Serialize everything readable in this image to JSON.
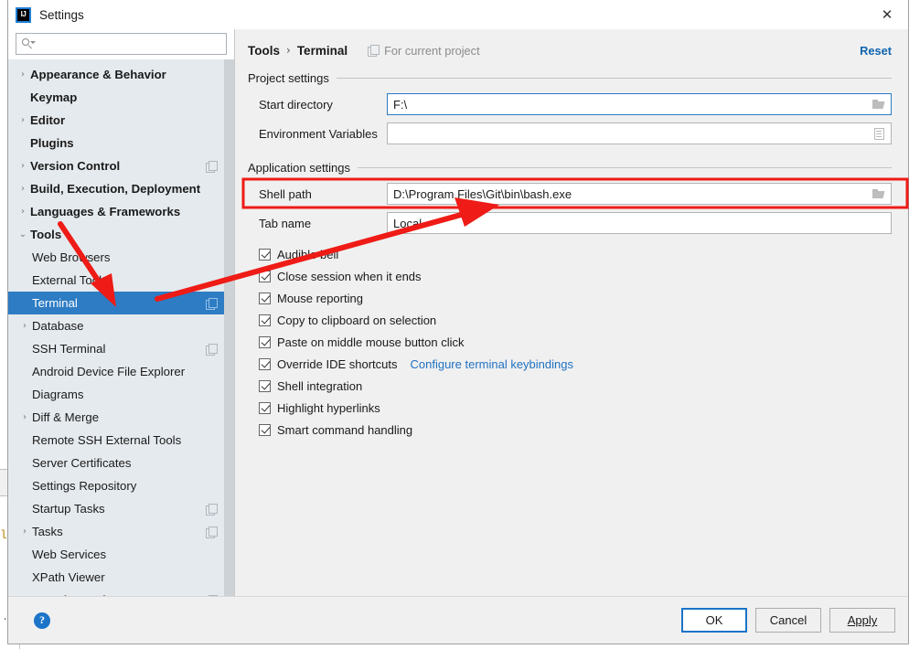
{
  "window": {
    "title": "Settings",
    "logo_text": "IJ",
    "close_icon": "✕"
  },
  "search": {
    "value": "",
    "placeholder": ""
  },
  "sidebar": {
    "items": [
      {
        "label": "Appearance & Behavior",
        "level": 0,
        "bold": true,
        "arrow": "›",
        "badge": false,
        "selected": false
      },
      {
        "label": "Keymap",
        "level": 0,
        "bold": true,
        "arrow": "",
        "badge": false,
        "selected": false
      },
      {
        "label": "Editor",
        "level": 0,
        "bold": true,
        "arrow": "›",
        "badge": false,
        "selected": false
      },
      {
        "label": "Plugins",
        "level": 0,
        "bold": true,
        "arrow": "",
        "badge": false,
        "selected": false
      },
      {
        "label": "Version Control",
        "level": 0,
        "bold": true,
        "arrow": "›",
        "badge": true,
        "selected": false
      },
      {
        "label": "Build, Execution, Deployment",
        "level": 0,
        "bold": true,
        "arrow": "›",
        "badge": false,
        "selected": false
      },
      {
        "label": "Languages & Frameworks",
        "level": 0,
        "bold": true,
        "arrow": "›",
        "badge": false,
        "selected": false
      },
      {
        "label": "Tools",
        "level": 0,
        "bold": true,
        "arrow": "⌄",
        "badge": false,
        "selected": false
      },
      {
        "label": "Web Browsers",
        "level": 1,
        "bold": false,
        "arrow": "",
        "badge": false,
        "selected": false
      },
      {
        "label": "External Tools",
        "level": 1,
        "bold": false,
        "arrow": "",
        "badge": false,
        "selected": false
      },
      {
        "label": "Terminal",
        "level": 1,
        "bold": false,
        "arrow": "",
        "badge": true,
        "selected": true
      },
      {
        "label": "Database",
        "level": 1,
        "bold": false,
        "arrow": "›",
        "badge": false,
        "selected": false
      },
      {
        "label": "SSH Terminal",
        "level": 1,
        "bold": false,
        "arrow": "",
        "badge": true,
        "selected": false
      },
      {
        "label": "Android Device File Explorer",
        "level": 1,
        "bold": false,
        "arrow": "",
        "badge": false,
        "selected": false
      },
      {
        "label": "Diagrams",
        "level": 1,
        "bold": false,
        "arrow": "",
        "badge": false,
        "selected": false
      },
      {
        "label": "Diff & Merge",
        "level": 1,
        "bold": false,
        "arrow": "›",
        "badge": false,
        "selected": false
      },
      {
        "label": "Remote SSH External Tools",
        "level": 1,
        "bold": false,
        "arrow": "",
        "badge": false,
        "selected": false
      },
      {
        "label": "Server Certificates",
        "level": 1,
        "bold": false,
        "arrow": "",
        "badge": false,
        "selected": false
      },
      {
        "label": "Settings Repository",
        "level": 1,
        "bold": false,
        "arrow": "",
        "badge": false,
        "selected": false
      },
      {
        "label": "Startup Tasks",
        "level": 1,
        "bold": false,
        "arrow": "",
        "badge": true,
        "selected": false
      },
      {
        "label": "Tasks",
        "level": 1,
        "bold": false,
        "arrow": "›",
        "badge": true,
        "selected": false
      },
      {
        "label": "Web Services",
        "level": 1,
        "bold": false,
        "arrow": "",
        "badge": false,
        "selected": false
      },
      {
        "label": "XPath Viewer",
        "level": 1,
        "bold": false,
        "arrow": "",
        "badge": false,
        "selected": false
      },
      {
        "label": "Experimental",
        "level": 0,
        "bold": true,
        "arrow": "",
        "badge": true,
        "selected": false
      }
    ]
  },
  "main": {
    "breadcrumb": {
      "parent": "Tools",
      "separator": "›",
      "current": "Terminal"
    },
    "scope_label": "For current project",
    "reset_label": "Reset",
    "project_settings": {
      "title": "Project settings",
      "start_directory": {
        "label": "Start directory",
        "value": "F:\\"
      },
      "environment_variables": {
        "label": "Environment Variables",
        "value": ""
      }
    },
    "application_settings": {
      "title": "Application settings",
      "shell_path": {
        "label": "Shell path",
        "value": "D:\\Program Files\\Git\\bin\\bash.exe"
      },
      "tab_name": {
        "label": "Tab name",
        "value": "Local"
      },
      "checkboxes": [
        {
          "label": "Audible bell",
          "checked": true,
          "link": ""
        },
        {
          "label": "Close session when it ends",
          "checked": true,
          "link": ""
        },
        {
          "label": "Mouse reporting",
          "checked": true,
          "link": ""
        },
        {
          "label": "Copy to clipboard on selection",
          "checked": true,
          "link": ""
        },
        {
          "label": "Paste on middle mouse button click",
          "checked": true,
          "link": ""
        },
        {
          "label": "Override IDE shortcuts",
          "checked": true,
          "link": "Configure terminal keybindings"
        },
        {
          "label": "Shell integration",
          "checked": true,
          "link": ""
        },
        {
          "label": "Highlight hyperlinks",
          "checked": true,
          "link": ""
        },
        {
          "label": "Smart command handling",
          "checked": true,
          "link": ""
        }
      ]
    }
  },
  "footer": {
    "help_label": "?",
    "ok_label": "OK",
    "cancel_label": "Cancel",
    "apply_label": "Apply"
  },
  "background": {
    "code_word": "le",
    "code_dot": "·",
    "code_dot2": "."
  },
  "annotation": {
    "highlight_color": "#ef1b16",
    "note": "red rectangle around Shell path row, arrow from Terminal item to Shell path field, arrow from Tools item down to Terminal item"
  }
}
